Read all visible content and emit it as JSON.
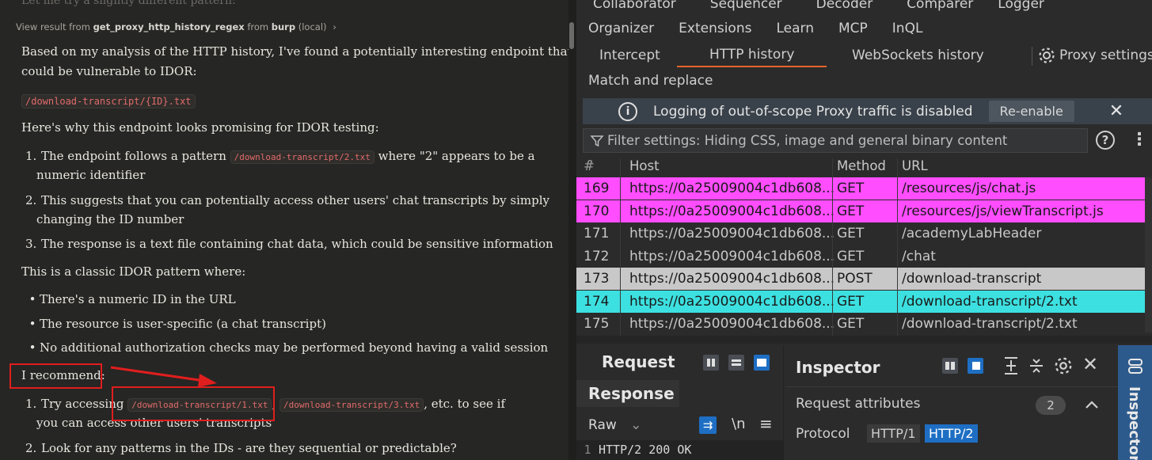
{
  "chat": {
    "faded_top": "Let me try a slightly different pattern:",
    "tool_result": {
      "prefix": "View result from",
      "tool": "get_proxy_http_history_regex",
      "mid": "from",
      "server": "burp",
      "suffix": "(local)",
      "chevron": "›"
    },
    "intro_1": "Based on my analysis of the HTTP history, I've found a potentially interesting endpoint that",
    "intro_2": "could be vulnerable to IDOR:",
    "endpoint": "/download-transcript/{ID}.txt",
    "why": "Here's why this endpoint looks promising for IDOR testing:",
    "points": [
      {
        "n": "1.",
        "a": "The endpoint follows a pattern",
        "code": "/download-transcript/2.txt",
        "b": "where \"2\" appears to be a",
        "c": "numeric identifier"
      },
      {
        "n": "2.",
        "a": "This suggests that you can potentially access other users' chat transcripts by simply",
        "c": "changing the ID number"
      },
      {
        "n": "3.",
        "a": "The response is a text file containing chat data, which could be sensitive information"
      }
    ],
    "classic": "This is a classic IDOR pattern where:",
    "bullets": [
      "There's a numeric ID in the URL",
      "The resource is user-specific (a chat transcript)",
      "No additional authorization checks may be performed beyond having a valid session"
    ],
    "bullet_mark": "•",
    "recommend": "I recommend:",
    "rec": [
      {
        "n": "1.",
        "a": "Try accessing",
        "code1": "/download-transcript/1.txt",
        "sep": ",",
        "code2": "/download-transcript/3.txt",
        "b": ", etc. to see if",
        "c": "you can access other users' transcripts"
      },
      {
        "n": "2.",
        "a": "Look for any patterns in the IDs - are they sequential or predictable?"
      }
    ]
  },
  "burp": {
    "menu_row1": [
      "Collaborator",
      "Sequencer",
      "Decoder",
      "Comparer",
      "Logger"
    ],
    "menu_row2": [
      "Organizer",
      "Extensions",
      "Learn",
      "MCP",
      "InQL"
    ],
    "proxy_tabs": [
      "Intercept",
      "HTTP history",
      "WebSockets history"
    ],
    "proxy_settings": "Proxy settings",
    "match_replace": "Match and replace",
    "banner": {
      "text": "Logging of out-of-scope Proxy traffic is disabled",
      "button": "Re-enable",
      "close": "✕",
      "info": "i"
    },
    "filter": "Filter settings: Hiding CSS, image and general binary content",
    "help": "?",
    "kebab": "⋮",
    "columns": {
      "num": "#",
      "sort": "^",
      "host": "Host",
      "method": "Method",
      "url": "URL"
    },
    "rows": [
      {
        "n": "169",
        "host": "https://0a25009004c1db608...",
        "method": "GET",
        "url": "/resources/js/chat.js",
        "hl": "magenta"
      },
      {
        "n": "170",
        "host": "https://0a25009004c1db608...",
        "method": "GET",
        "url": "/resources/js/viewTranscript.js",
        "hl": "magenta"
      },
      {
        "n": "171",
        "host": "https://0a25009004c1db608...",
        "method": "GET",
        "url": "/academyLabHeader",
        "hl": ""
      },
      {
        "n": "172",
        "host": "https://0a25009004c1db608...",
        "method": "GET",
        "url": "/chat",
        "hl": ""
      },
      {
        "n": "173",
        "host": "https://0a25009004c1db608...",
        "method": "POST",
        "url": "/download-transcript",
        "hl": "gray"
      },
      {
        "n": "174",
        "host": "https://0a25009004c1db608...",
        "method": "GET",
        "url": "/download-transcript/2.txt",
        "hl": "cyan"
      },
      {
        "n": "175",
        "host": "https://0a25009004c1db608...",
        "method": "GET",
        "url": "/download-transcript/2.txt",
        "hl": ""
      }
    ],
    "request_tab": "Request",
    "response_tab": "Response",
    "raw": "Raw",
    "raw_caret": "⌄",
    "newline": "\\n",
    "menu": "≡",
    "line_no": "1",
    "first_line": "HTTP/2 200 OK",
    "inspector": "Inspector",
    "req_attr": "Request attributes",
    "req_attr_count": "2",
    "protocol_label": "Protocol",
    "protocol_opts": [
      "HTTP/1",
      "HTTP/2"
    ],
    "side_tab": "Inspector",
    "colors": {
      "accent": "#e8632b",
      "magenta": "#ff4dff",
      "cyan": "#3de0e0",
      "selected_blue": "#1e6fc4",
      "annotation_red": "#e01e1e"
    }
  }
}
